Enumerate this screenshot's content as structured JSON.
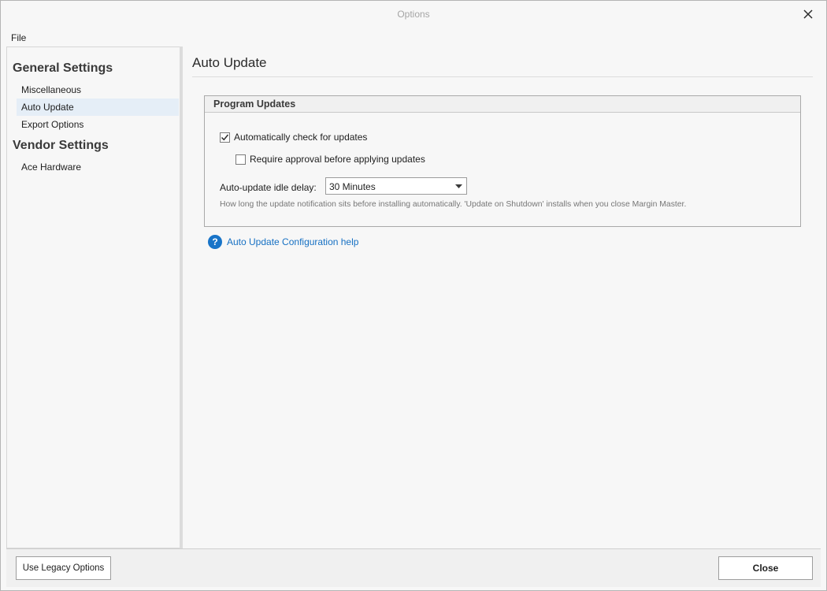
{
  "window": {
    "title": "Options"
  },
  "menu": {
    "file": "File"
  },
  "sidebar": {
    "groups": [
      {
        "heading": "General Settings",
        "items": [
          "Miscellaneous",
          "Auto Update",
          "Export Options"
        ]
      },
      {
        "heading": "Vendor Settings",
        "items": [
          "Ace Hardware"
        ]
      }
    ],
    "selected": "Auto Update"
  },
  "content": {
    "title": "Auto Update",
    "group_title": "Program Updates",
    "auto_check_label": "Automatically check for updates",
    "auto_check_checked": true,
    "require_approval_label": "Require approval before applying updates",
    "require_approval_checked": false,
    "idle_delay_label": "Auto-update idle delay:",
    "idle_delay_value": "30 Minutes",
    "hint": "How long the update notification sits before installing automatically. 'Update on Shutdown' installs when you close Margin Master.",
    "help_icon_text": "?",
    "help_link": "Auto Update Configuration help"
  },
  "footer": {
    "legacy_button": "Use Legacy Options",
    "close_button": "Close"
  },
  "colors": {
    "selection": "#e5eef7",
    "link": "#1670c3",
    "help_icon": "#1874c8",
    "title_text": "#a5a5a5"
  },
  "icons": {
    "close": "close-icon",
    "check": "checkmark-icon",
    "dropdown": "chevron-down-icon",
    "help": "help-circle-icon"
  }
}
